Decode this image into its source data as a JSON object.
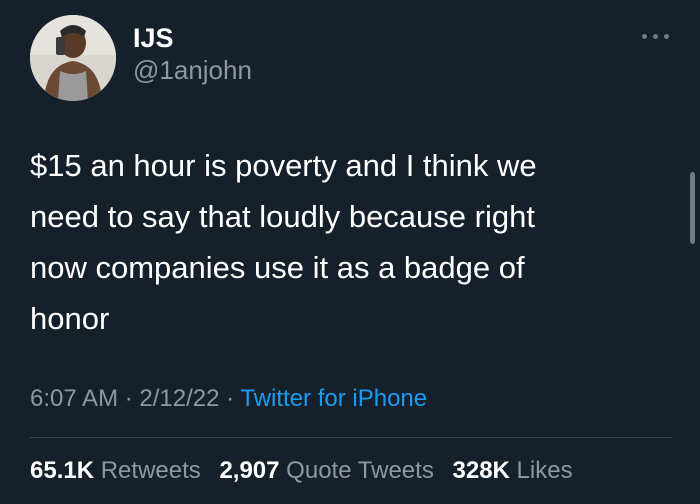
{
  "author": {
    "display_name": "IJS",
    "handle": "@1anjohn"
  },
  "tweet": {
    "text": "$15 an hour is poverty and I think we\nneed to say that loudly because right\nnow companies use it as a badge of\nhonor",
    "time": "6:07 AM",
    "separator": " · ",
    "date": "2/12/22",
    "source": "Twitter for iPhone"
  },
  "stats": {
    "retweets_count": "65.1K",
    "retweets_label": "Retweets",
    "quote_count": "2,907",
    "quote_label": "Quote Tweets",
    "likes_count": "328K",
    "likes_label": "Likes"
  },
  "colors": {
    "background": "#15202b",
    "text_primary": "#ffffff",
    "text_secondary": "#8b98a5",
    "link": "#1d9bf0",
    "divider": "#38444d"
  },
  "icons": {
    "more": "more-horizontal-icon"
  }
}
